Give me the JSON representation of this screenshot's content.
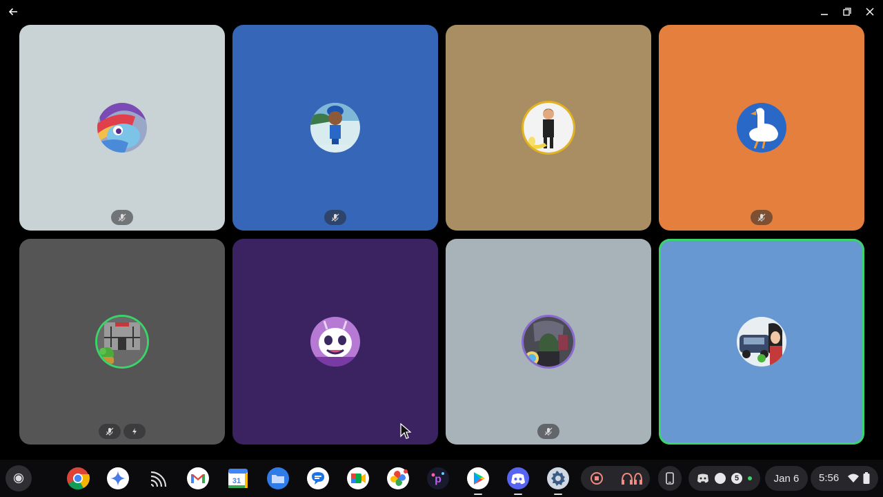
{
  "window": {
    "back_icon": "arrow-back-icon",
    "controls": [
      "minimize-icon",
      "restore-icon",
      "close-icon"
    ]
  },
  "tiles": [
    {
      "bg": "#c9d3d6",
      "avatar": "rainbow-pony-avatar",
      "badges": [
        "mic-off-icon"
      ],
      "active": false
    },
    {
      "bg": "#3566b7",
      "avatar": "boy-blue-cap-avatar",
      "badges": [
        "mic-off-icon"
      ],
      "active": false
    },
    {
      "bg": "#a88e62",
      "avatar": "figure-banana-avatar",
      "badges": [],
      "active": false
    },
    {
      "bg": "#e47f3d",
      "avatar": "white-goose-avatar",
      "badges": [
        "mic-off-icon"
      ],
      "active": false
    },
    {
      "bg": "#555555",
      "avatar": "scene-frog-avatar",
      "badges": [
        "mic-off-icon",
        "boost-icon"
      ],
      "active": false
    },
    {
      "bg": "#3b2260",
      "avatar": "purple-creature-avatar",
      "badges": [],
      "active": false
    },
    {
      "bg": "#a8b2b9",
      "avatar": "dark-character-avatar",
      "badges": [
        "mic-off-icon"
      ],
      "active": false
    },
    {
      "bg": "#6898d1",
      "avatar": "car-character-avatar",
      "badges": [],
      "active": true
    }
  ],
  "shelf": {
    "launcher_icon": "launcher-icon",
    "apps": [
      {
        "name": "chrome-icon",
        "active": false
      },
      {
        "name": "gemini-icon",
        "active": false
      },
      {
        "name": "cast-icon",
        "active": false
      },
      {
        "name": "gmail-icon",
        "active": false
      },
      {
        "name": "calendar-icon",
        "active": false
      },
      {
        "name": "files-icon",
        "active": false
      },
      {
        "name": "messages-icon",
        "active": false
      },
      {
        "name": "meet-icon",
        "active": false
      },
      {
        "name": "photos-icon",
        "active": false
      },
      {
        "name": "picsart-icon",
        "active": false
      },
      {
        "name": "play-store-icon",
        "active": true
      },
      {
        "name": "discord-icon",
        "active": true
      },
      {
        "name": "settings-icon",
        "active": true
      }
    ],
    "calendar_day": "31",
    "tray": {
      "notification_count": "5",
      "date": "Jan 6",
      "time": "5:56"
    }
  }
}
